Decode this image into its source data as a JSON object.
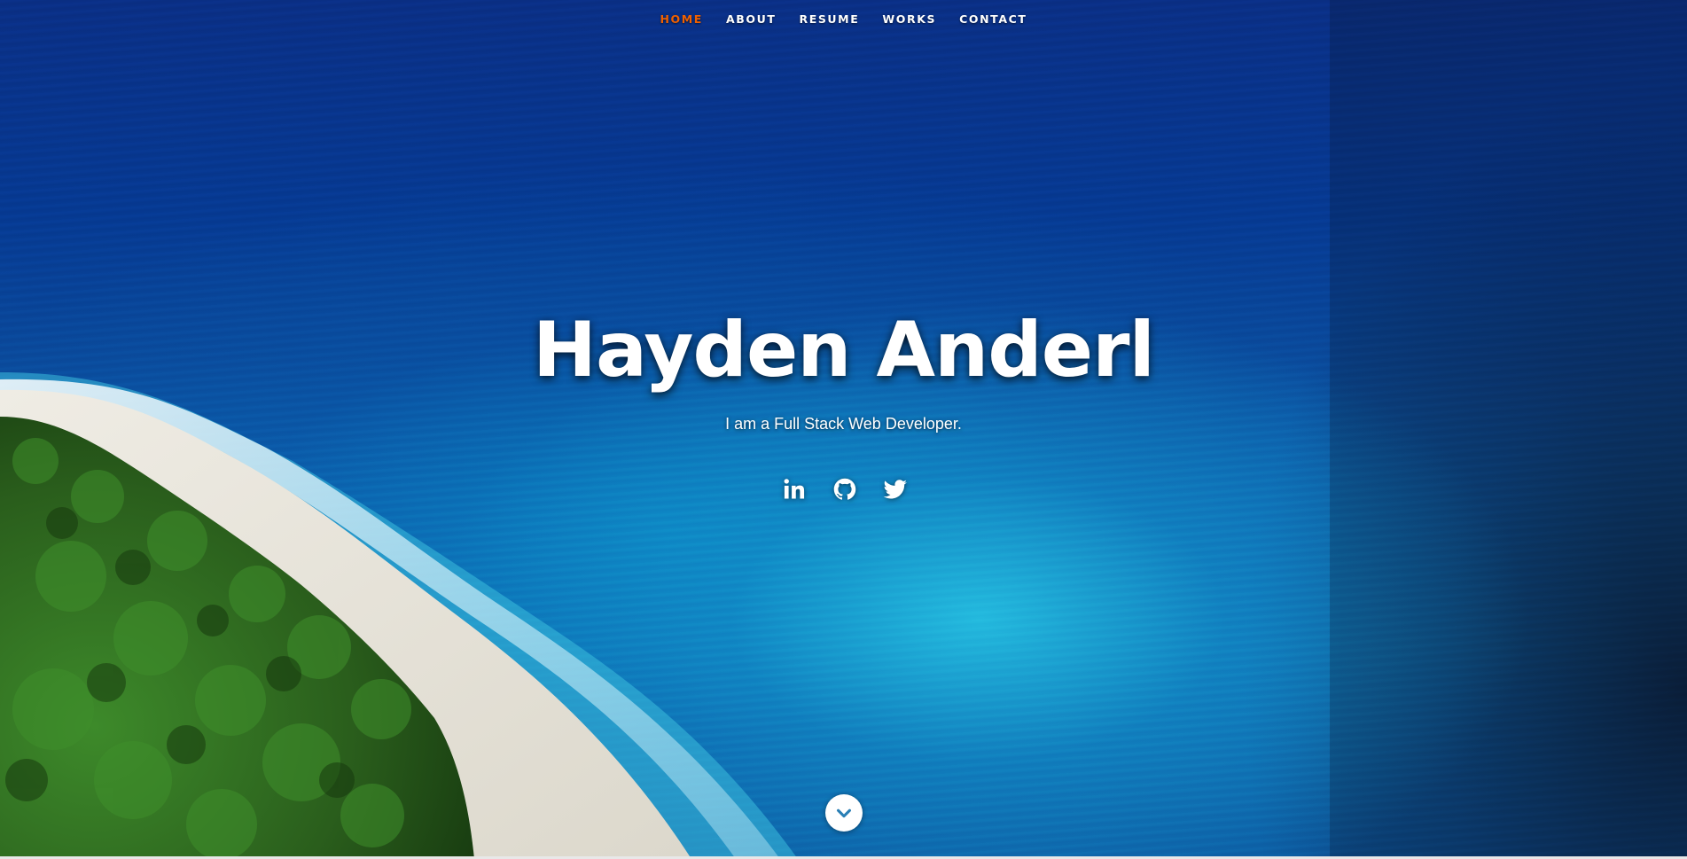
{
  "nav": {
    "items": [
      {
        "label": "HOME",
        "active": true
      },
      {
        "label": "ABOUT",
        "active": false
      },
      {
        "label": "RESUME",
        "active": false
      },
      {
        "label": "WORKS",
        "active": false
      },
      {
        "label": "CONTACT",
        "active": false
      }
    ],
    "active_color": "#f06000",
    "text_color": "#ffffff"
  },
  "banner": {
    "title": "Hayden Anderl",
    "subtitle": "I am a Full Stack Web Developer."
  },
  "social": {
    "links": [
      {
        "icon": "linkedin-icon"
      },
      {
        "icon": "github-icon"
      },
      {
        "icon": "twitter-icon"
      }
    ]
  },
  "scroll_down": {
    "icon": "chevron-down-icon"
  },
  "background": {
    "scene": "aerial-ocean-beach",
    "ocean_color": "#0a3f96",
    "shallow_color": "#1fb4d8",
    "sand_color": "#e9e6dc",
    "palm_color": "#2f6b1e"
  }
}
